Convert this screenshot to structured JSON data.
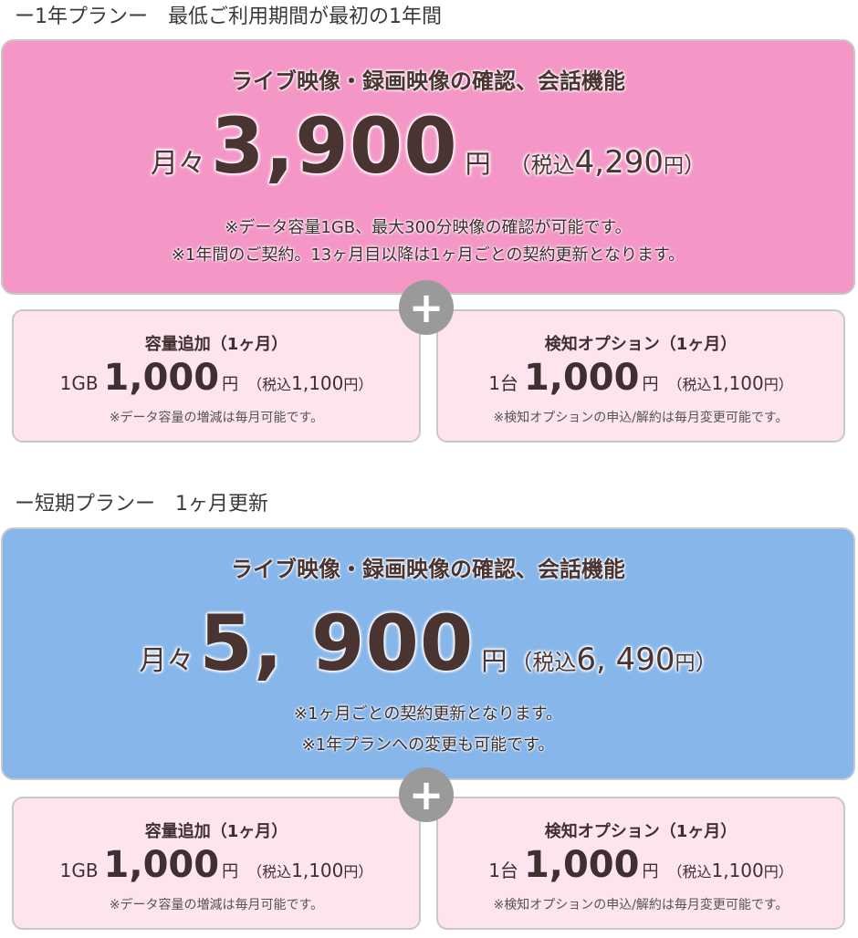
{
  "plan_annual": {
    "heading": "ー1年プランー　最低ご利用期間が最初の1年間",
    "card_color": "#f497c7",
    "feature": "ライブ映像・録画映像の確認、会話機能",
    "per": "月々",
    "price": "3,900",
    "yen": "円",
    "tax_open": "（",
    "tax_label": "税込",
    "tax_value": "4,290",
    "tax_yen": "円",
    "tax_close": "）",
    "note1": "※データ容量1GB、最大300分映像の確認が可能です。",
    "note2": "※1年間のご契約。13ヶ月目以降は1ヶ月ごとの契約更新となります。",
    "plus": "+",
    "addons": [
      {
        "title": "容量追加（1ヶ月）",
        "unit": "1GB",
        "price": "1,000",
        "yen": "円",
        "tax_open": "（",
        "tax_label": "税込",
        "tax_value": "1,100",
        "tax_yen": "円",
        "tax_close": "）",
        "note": "※データ容量の増減は毎月可能です。"
      },
      {
        "title": "検知オプション（1ヶ月）",
        "unit": "1台",
        "price": "1,000",
        "yen": "円",
        "tax_open": "（",
        "tax_label": "税込",
        "tax_value": "1,100",
        "tax_yen": "円",
        "tax_close": "）",
        "note": "※検知オプションの申込/解約は毎月変更可能です。"
      }
    ]
  },
  "plan_short": {
    "heading": "ー短期プランー　1ヶ月更新",
    "card_color": "#86b6ea",
    "feature": "ライブ映像・録画映像の確認、会話機能",
    "per": "月々",
    "price": "5, 900",
    "yen": "円",
    "tax_open": "（",
    "tax_label": "税込",
    "tax_value": "6, 490",
    "tax_yen": "円",
    "tax_close": "）",
    "note1": "※1ヶ月ごとの契約更新となります。",
    "note2": "※1年プランへの変更も可能です。",
    "plus": "+",
    "addons": [
      {
        "title": "容量追加（1ヶ月）",
        "unit": "1GB",
        "price": "1,000",
        "yen": "円",
        "tax_open": "（",
        "tax_label": "税込",
        "tax_value": "1,100",
        "tax_yen": "円",
        "tax_close": "）",
        "note": "※データ容量の増減は毎月可能です。"
      },
      {
        "title": "検知オプション（1ヶ月）",
        "unit": "1台",
        "price": "1,000",
        "yen": "円",
        "tax_open": "（",
        "tax_label": "税込",
        "tax_value": "1,100",
        "tax_yen": "円",
        "tax_close": "）",
        "note": "※検知オプションの申込/解約は毎月変更可能です。"
      }
    ]
  }
}
